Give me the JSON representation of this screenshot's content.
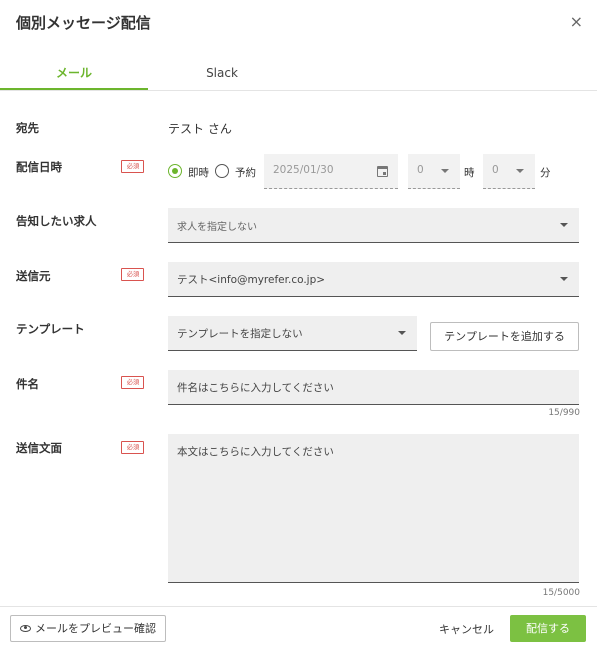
{
  "dialog": {
    "title": "個別メッセージ配信",
    "close_glyph": "×"
  },
  "tabs": [
    {
      "label": "メール",
      "active": true
    },
    {
      "label": "Slack",
      "active": false
    }
  ],
  "form": {
    "recipient": {
      "label": "宛先",
      "value": "テスト さん"
    },
    "schedule": {
      "label": "配信日時",
      "required_badge": "必須",
      "option_now": "即時",
      "option_reserve": "予約",
      "selected": "即時",
      "date_placeholder": "2025/01/30",
      "hour_value": "0",
      "hour_unit": "時",
      "minute_value": "0",
      "minute_unit": "分"
    },
    "job": {
      "label": "告知したい求人",
      "placeholder": "求人を指定しない"
    },
    "sender": {
      "label": "送信元",
      "required_badge": "必須",
      "value": "テスト<info@myrefer.co.jp>"
    },
    "template": {
      "label": "テンプレート",
      "placeholder": "テンプレートを指定しない",
      "add_button": "テンプレートを追加する"
    },
    "subject": {
      "label": "件名",
      "required_badge": "必須",
      "placeholder": "件名はこちらに入力してください",
      "counter": "15/990"
    },
    "body": {
      "label": "送信文面",
      "required_badge": "必須",
      "placeholder": "本文はこちらに入力してください",
      "counter": "15/5000"
    }
  },
  "footer": {
    "preview_button": "メールをプレビュー確認",
    "cancel_button": "キャンセル",
    "send_button": "配信する"
  },
  "colors": {
    "accent": "#6cb52d",
    "primary_button": "#7cc142",
    "required": "#d9534f"
  }
}
